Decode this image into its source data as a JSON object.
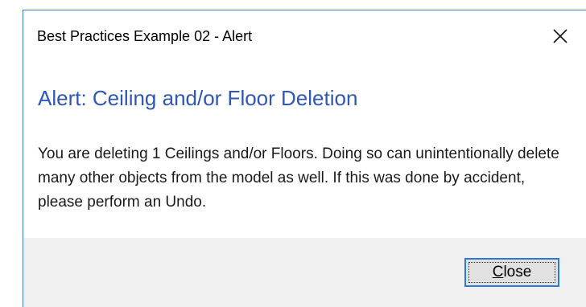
{
  "dialog": {
    "title": "Best Practices Example 02 - Alert",
    "close_icon": "close-icon",
    "heading": "Alert: Ceiling and/or Floor Deletion",
    "message": "You are deleting 1 Ceilings and/or Floors. Doing so can unintentionally delete many other objects from the model as well. If this was done by accident, please perform an Undo.",
    "close_button": {
      "mnemonic": "C",
      "rest": "lose"
    },
    "colors": {
      "heading": "#2f57b5",
      "border": "#3c78c8",
      "footer": "#f0f0f0",
      "button_focus": "#2f79d7"
    }
  }
}
